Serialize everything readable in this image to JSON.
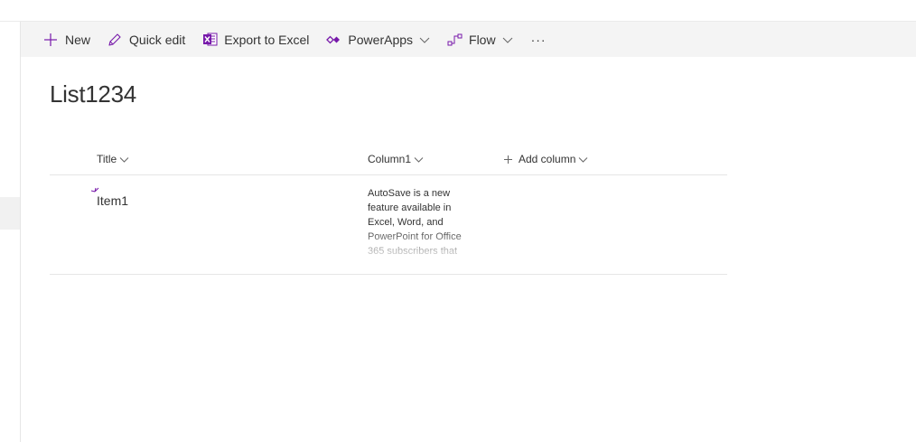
{
  "command_bar": {
    "new_label": "New",
    "quick_edit_label": "Quick edit",
    "export_label": "Export to Excel",
    "powerapps_label": "PowerApps",
    "flow_label": "Flow",
    "more_label": "···"
  },
  "list": {
    "title": "List1234",
    "columns": {
      "title": "Title",
      "column1": "Column1",
      "add_column": "Add column"
    },
    "rows": [
      {
        "title": "Item1",
        "column1": "AutoSave is a new feature available in Excel, Word, and PowerPoint for Office 365 subscribers that"
      }
    ]
  },
  "colors": {
    "accent": "#7719aa",
    "command_bar_bg": "#f4f4f4",
    "excel_icon": "#7719aa"
  },
  "icons": {
    "new": "plus-icon",
    "quick_edit": "pencil-icon",
    "export": "excel-icon",
    "powerapps": "powerapps-icon",
    "flow": "flow-icon"
  }
}
